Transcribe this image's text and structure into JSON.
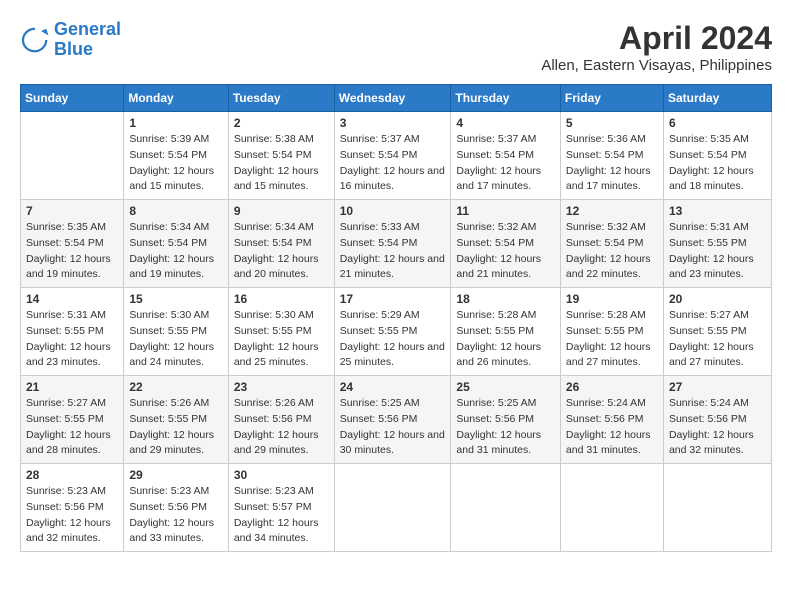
{
  "logo": {
    "line1": "General",
    "line2": "Blue"
  },
  "title": "April 2024",
  "subtitle": "Allen, Eastern Visayas, Philippines",
  "headers": [
    "Sunday",
    "Monday",
    "Tuesday",
    "Wednesday",
    "Thursday",
    "Friday",
    "Saturday"
  ],
  "weeks": [
    [
      {
        "day": "",
        "sunrise": "",
        "sunset": "",
        "daylight": ""
      },
      {
        "day": "1",
        "sunrise": "Sunrise: 5:39 AM",
        "sunset": "Sunset: 5:54 PM",
        "daylight": "Daylight: 12 hours and 15 minutes."
      },
      {
        "day": "2",
        "sunrise": "Sunrise: 5:38 AM",
        "sunset": "Sunset: 5:54 PM",
        "daylight": "Daylight: 12 hours and 15 minutes."
      },
      {
        "day": "3",
        "sunrise": "Sunrise: 5:37 AM",
        "sunset": "Sunset: 5:54 PM",
        "daylight": "Daylight: 12 hours and 16 minutes."
      },
      {
        "day": "4",
        "sunrise": "Sunrise: 5:37 AM",
        "sunset": "Sunset: 5:54 PM",
        "daylight": "Daylight: 12 hours and 17 minutes."
      },
      {
        "day": "5",
        "sunrise": "Sunrise: 5:36 AM",
        "sunset": "Sunset: 5:54 PM",
        "daylight": "Daylight: 12 hours and 17 minutes."
      },
      {
        "day": "6",
        "sunrise": "Sunrise: 5:35 AM",
        "sunset": "Sunset: 5:54 PM",
        "daylight": "Daylight: 12 hours and 18 minutes."
      }
    ],
    [
      {
        "day": "7",
        "sunrise": "Sunrise: 5:35 AM",
        "sunset": "Sunset: 5:54 PM",
        "daylight": "Daylight: 12 hours and 19 minutes."
      },
      {
        "day": "8",
        "sunrise": "Sunrise: 5:34 AM",
        "sunset": "Sunset: 5:54 PM",
        "daylight": "Daylight: 12 hours and 19 minutes."
      },
      {
        "day": "9",
        "sunrise": "Sunrise: 5:34 AM",
        "sunset": "Sunset: 5:54 PM",
        "daylight": "Daylight: 12 hours and 20 minutes."
      },
      {
        "day": "10",
        "sunrise": "Sunrise: 5:33 AM",
        "sunset": "Sunset: 5:54 PM",
        "daylight": "Daylight: 12 hours and 21 minutes."
      },
      {
        "day": "11",
        "sunrise": "Sunrise: 5:32 AM",
        "sunset": "Sunset: 5:54 PM",
        "daylight": "Daylight: 12 hours and 21 minutes."
      },
      {
        "day": "12",
        "sunrise": "Sunrise: 5:32 AM",
        "sunset": "Sunset: 5:54 PM",
        "daylight": "Daylight: 12 hours and 22 minutes."
      },
      {
        "day": "13",
        "sunrise": "Sunrise: 5:31 AM",
        "sunset": "Sunset: 5:55 PM",
        "daylight": "Daylight: 12 hours and 23 minutes."
      }
    ],
    [
      {
        "day": "14",
        "sunrise": "Sunrise: 5:31 AM",
        "sunset": "Sunset: 5:55 PM",
        "daylight": "Daylight: 12 hours and 23 minutes."
      },
      {
        "day": "15",
        "sunrise": "Sunrise: 5:30 AM",
        "sunset": "Sunset: 5:55 PM",
        "daylight": "Daylight: 12 hours and 24 minutes."
      },
      {
        "day": "16",
        "sunrise": "Sunrise: 5:30 AM",
        "sunset": "Sunset: 5:55 PM",
        "daylight": "Daylight: 12 hours and 25 minutes."
      },
      {
        "day": "17",
        "sunrise": "Sunrise: 5:29 AM",
        "sunset": "Sunset: 5:55 PM",
        "daylight": "Daylight: 12 hours and 25 minutes."
      },
      {
        "day": "18",
        "sunrise": "Sunrise: 5:28 AM",
        "sunset": "Sunset: 5:55 PM",
        "daylight": "Daylight: 12 hours and 26 minutes."
      },
      {
        "day": "19",
        "sunrise": "Sunrise: 5:28 AM",
        "sunset": "Sunset: 5:55 PM",
        "daylight": "Daylight: 12 hours and 27 minutes."
      },
      {
        "day": "20",
        "sunrise": "Sunrise: 5:27 AM",
        "sunset": "Sunset: 5:55 PM",
        "daylight": "Daylight: 12 hours and 27 minutes."
      }
    ],
    [
      {
        "day": "21",
        "sunrise": "Sunrise: 5:27 AM",
        "sunset": "Sunset: 5:55 PM",
        "daylight": "Daylight: 12 hours and 28 minutes."
      },
      {
        "day": "22",
        "sunrise": "Sunrise: 5:26 AM",
        "sunset": "Sunset: 5:55 PM",
        "daylight": "Daylight: 12 hours and 29 minutes."
      },
      {
        "day": "23",
        "sunrise": "Sunrise: 5:26 AM",
        "sunset": "Sunset: 5:56 PM",
        "daylight": "Daylight: 12 hours and 29 minutes."
      },
      {
        "day": "24",
        "sunrise": "Sunrise: 5:25 AM",
        "sunset": "Sunset: 5:56 PM",
        "daylight": "Daylight: 12 hours and 30 minutes."
      },
      {
        "day": "25",
        "sunrise": "Sunrise: 5:25 AM",
        "sunset": "Sunset: 5:56 PM",
        "daylight": "Daylight: 12 hours and 31 minutes."
      },
      {
        "day": "26",
        "sunrise": "Sunrise: 5:24 AM",
        "sunset": "Sunset: 5:56 PM",
        "daylight": "Daylight: 12 hours and 31 minutes."
      },
      {
        "day": "27",
        "sunrise": "Sunrise: 5:24 AM",
        "sunset": "Sunset: 5:56 PM",
        "daylight": "Daylight: 12 hours and 32 minutes."
      }
    ],
    [
      {
        "day": "28",
        "sunrise": "Sunrise: 5:23 AM",
        "sunset": "Sunset: 5:56 PM",
        "daylight": "Daylight: 12 hours and 32 minutes."
      },
      {
        "day": "29",
        "sunrise": "Sunrise: 5:23 AM",
        "sunset": "Sunset: 5:56 PM",
        "daylight": "Daylight: 12 hours and 33 minutes."
      },
      {
        "day": "30",
        "sunrise": "Sunrise: 5:23 AM",
        "sunset": "Sunset: 5:57 PM",
        "daylight": "Daylight: 12 hours and 34 minutes."
      },
      {
        "day": "",
        "sunrise": "",
        "sunset": "",
        "daylight": ""
      },
      {
        "day": "",
        "sunrise": "",
        "sunset": "",
        "daylight": ""
      },
      {
        "day": "",
        "sunrise": "",
        "sunset": "",
        "daylight": ""
      },
      {
        "day": "",
        "sunrise": "",
        "sunset": "",
        "daylight": ""
      }
    ]
  ]
}
